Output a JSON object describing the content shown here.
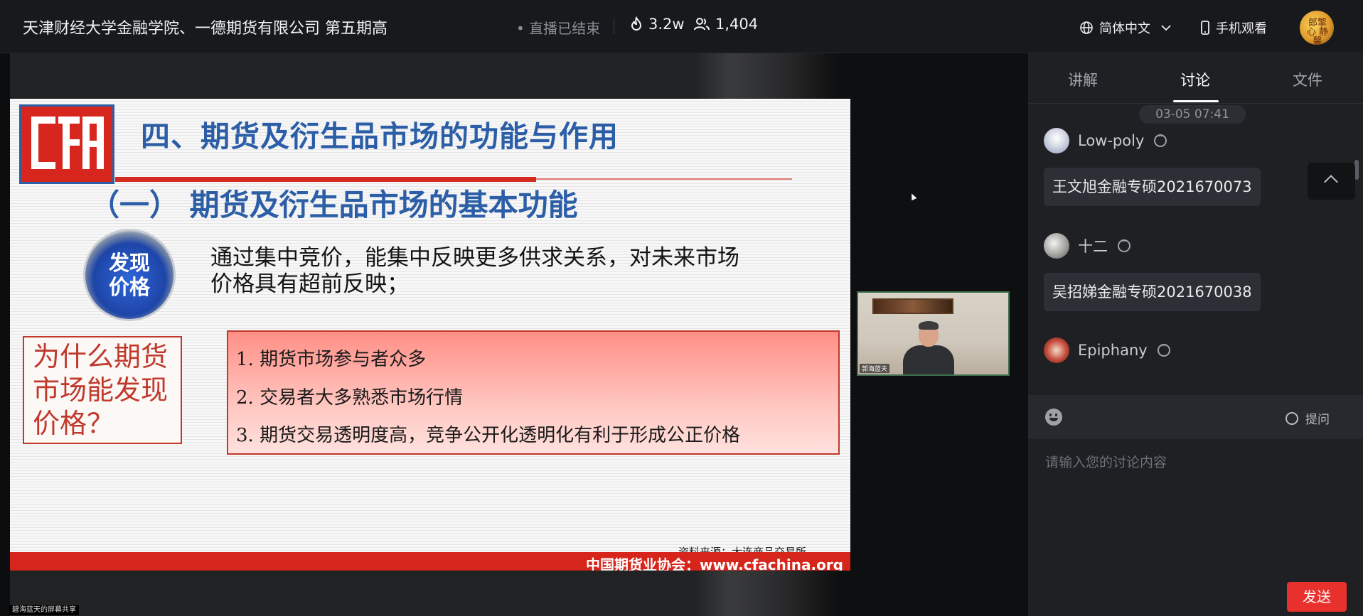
{
  "header": {
    "title": "天津财经大学金融学院、一德期货有限公司 第五期高",
    "live_status": "• 直播已结束",
    "views": "3.2w",
    "viewers": "1,404",
    "language": "简体中文",
    "mobile_watch": "手机观看",
    "avatar_text": "郎擎心 静馨"
  },
  "slide": {
    "heading": "四、期货及衍生品市场的功能与作用",
    "subheading": "（一） 期货及衍生品市场的基本功能",
    "badge_line1": "发现",
    "badge_line2": "价格",
    "body_line1": "通过集中竞价，能集中反映更多供求关系，对未来市场",
    "body_line2": "价格具有超前反映；",
    "why_line1": "为什么期货",
    "why_line2": "市场能发现",
    "why_line3": "价格？",
    "reasons": [
      "1. 期货市场参与者众多",
      "2. 交易者大多熟悉市场行情",
      "3. 期货交易透明度高，竞争公开化透明化有利于形成公正价格"
    ],
    "source": "资料来源：大连商品交易所",
    "footer": "中国期货业协会：www.cfachina.org"
  },
  "webcam": {
    "name": "郭海蓝天"
  },
  "screen_share_label": "碧海蓝天的屏幕共享",
  "panel": {
    "tabs": [
      "讲解",
      "讨论",
      "文件"
    ],
    "active_tab": "讨论",
    "timestamp": "03-05 07:41",
    "messages": [
      {
        "user": "Low-poly",
        "text": "王文旭金融专硕2021670073"
      },
      {
        "user": "十二",
        "text": "吴招娣金融专硕2021670038"
      },
      {
        "user": "Epiphany",
        "text": ""
      }
    ],
    "ask_label": "提问",
    "input_placeholder": "请输入您的讨论内容",
    "send_label": "发送"
  },
  "colors": {
    "accent_red": "#e8312c",
    "slide_blue": "#2b5ea7",
    "slide_red": "#d6261c"
  }
}
